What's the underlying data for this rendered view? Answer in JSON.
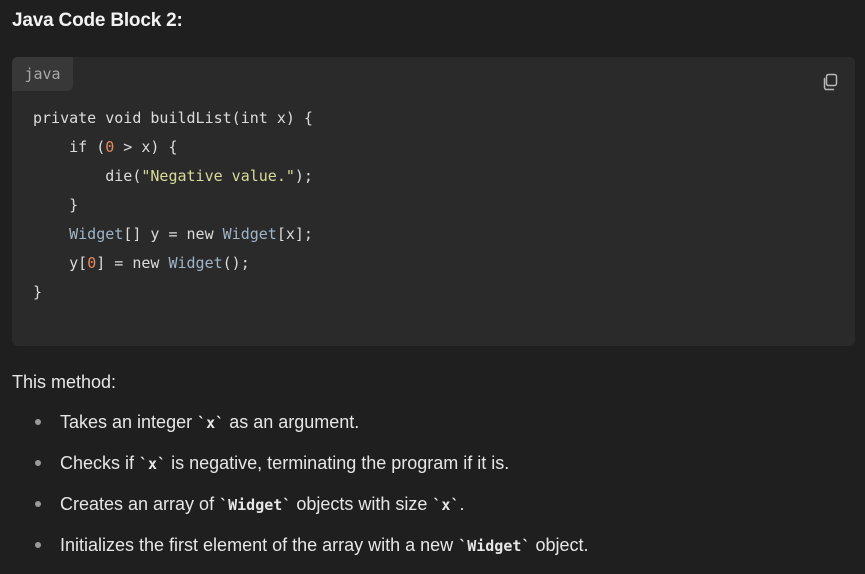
{
  "heading": "Java Code Block 2:",
  "code_block": {
    "language": "java",
    "copy_icon": "copy-icon",
    "lines": [
      [
        {
          "t": "plain",
          "v": "private void buildList(int x) {"
        }
      ],
      [
        {
          "t": "plain",
          "v": "    if ("
        },
        {
          "t": "num",
          "v": "0"
        },
        {
          "t": "plain",
          "v": " > x) {"
        }
      ],
      [
        {
          "t": "plain",
          "v": "        die("
        },
        {
          "t": "str",
          "v": "\"Negative value.\""
        },
        {
          "t": "plain",
          "v": ");"
        }
      ],
      [
        {
          "t": "plain",
          "v": "    }"
        }
      ],
      [
        {
          "t": "plain",
          "v": "    "
        },
        {
          "t": "type",
          "v": "Widget"
        },
        {
          "t": "plain",
          "v": "[] y = new "
        },
        {
          "t": "type",
          "v": "Widget"
        },
        {
          "t": "plain",
          "v": "[x];"
        }
      ],
      [
        {
          "t": "plain",
          "v": "    y["
        },
        {
          "t": "num",
          "v": "0"
        },
        {
          "t": "plain",
          "v": "] = new "
        },
        {
          "t": "type",
          "v": "Widget"
        },
        {
          "t": "plain",
          "v": "();"
        }
      ],
      [
        {
          "t": "plain",
          "v": "}"
        }
      ]
    ],
    "colors": {
      "background": "#2a2a2a",
      "number": "#e8895e",
      "string": "#d7db9a",
      "type": "#9fb4c8"
    }
  },
  "description": {
    "intro": "This method:",
    "points": [
      [
        {
          "t": "text",
          "v": "Takes an integer "
        },
        {
          "t": "code",
          "v": "`x`"
        },
        {
          "t": "text",
          "v": " as an argument."
        }
      ],
      [
        {
          "t": "text",
          "v": "Checks if "
        },
        {
          "t": "code",
          "v": "`x`"
        },
        {
          "t": "text",
          "v": " is negative, terminating the program if it is."
        }
      ],
      [
        {
          "t": "text",
          "v": "Creates an array of "
        },
        {
          "t": "code",
          "v": "`Widget`"
        },
        {
          "t": "text",
          "v": " objects with size "
        },
        {
          "t": "code",
          "v": "`x`"
        },
        {
          "t": "text",
          "v": "."
        }
      ],
      [
        {
          "t": "text",
          "v": "Initializes the first element of the array with a new "
        },
        {
          "t": "code",
          "v": "`Widget`"
        },
        {
          "t": "text",
          "v": " object."
        }
      ]
    ]
  }
}
